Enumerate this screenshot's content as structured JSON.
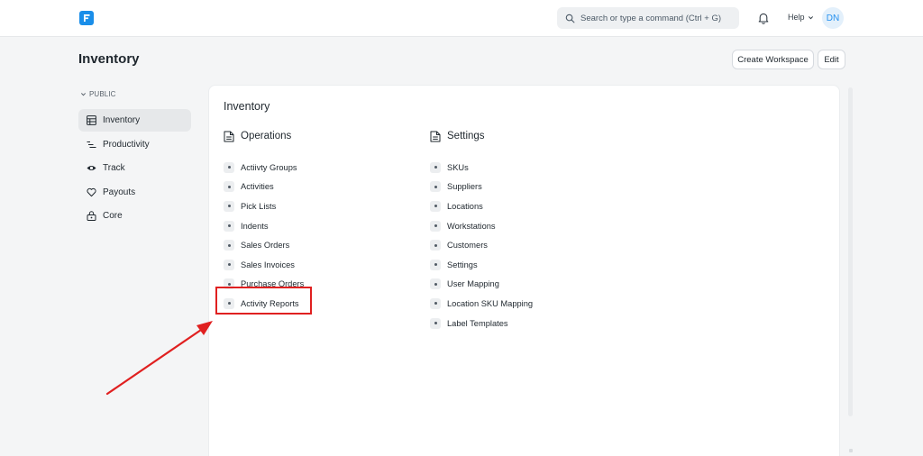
{
  "navbar": {
    "search_placeholder": "Search or type a command (Ctrl + G)",
    "help_label": "Help",
    "avatar_initials": "DN"
  },
  "header": {
    "title": "Inventory",
    "create_workspace_label": "Create Workspace",
    "edit_label": "Edit"
  },
  "sidebar": {
    "section_label": "PUBLIC",
    "items": [
      {
        "label": "Inventory",
        "icon": "table-icon",
        "active": true
      },
      {
        "label": "Productivity",
        "icon": "list-sort-icon",
        "active": false
      },
      {
        "label": "Track",
        "icon": "eye-icon",
        "active": false
      },
      {
        "label": "Payouts",
        "icon": "heart-icon",
        "active": false
      },
      {
        "label": "Core",
        "icon": "lock-icon",
        "active": false
      }
    ]
  },
  "card": {
    "title": "Inventory",
    "operations": {
      "heading": "Operations",
      "links": [
        "Actiivty Groups",
        "Activities",
        "Pick Lists",
        "Indents",
        "Sales Orders",
        "Sales Invoices",
        "Purchase Orders",
        "Activity Reports"
      ]
    },
    "settings": {
      "heading": "Settings",
      "links": [
        "SKUs",
        "Suppliers",
        "Locations",
        "Workstations",
        "Customers",
        "Settings",
        "User Mapping",
        "Location SKU Mapping",
        "Label Templates"
      ]
    }
  },
  "colors": {
    "accent": "#2490ef",
    "logo": "#1a8ee9",
    "annotation": "#e02020"
  }
}
